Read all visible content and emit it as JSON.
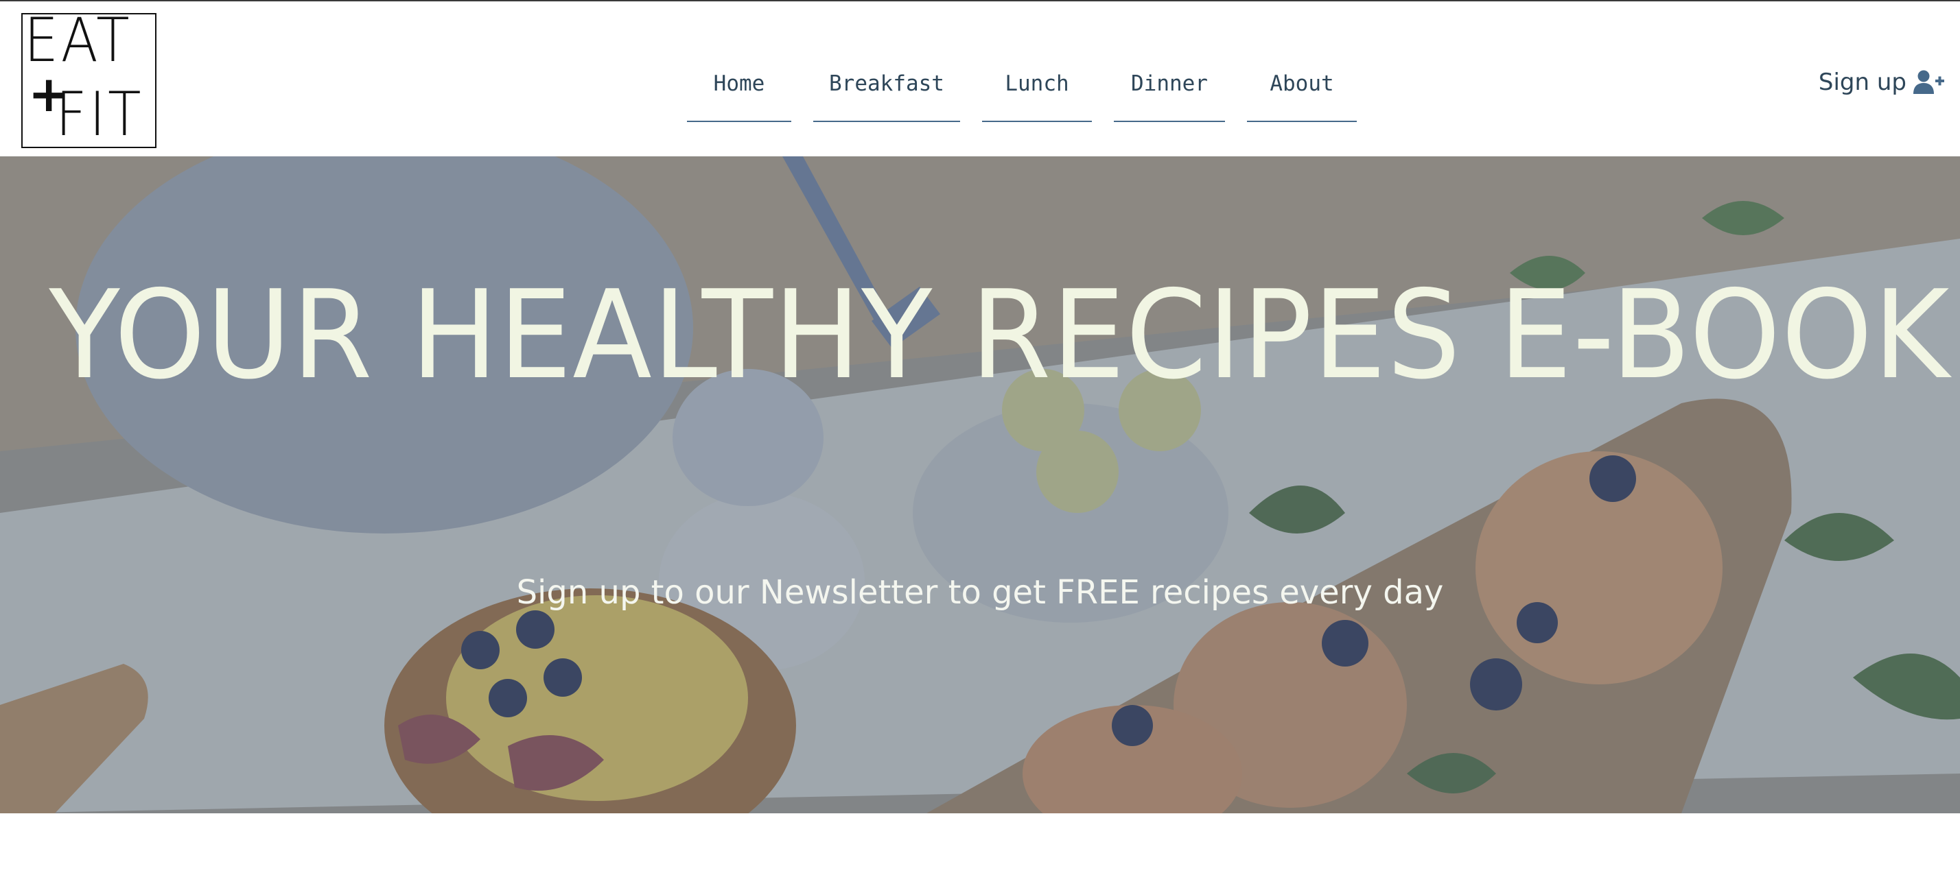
{
  "logo": {
    "line1": "EAT",
    "symbol": "+",
    "line2": "FIT"
  },
  "nav": {
    "items": [
      {
        "label": "Home"
      },
      {
        "label": "Breakfast"
      },
      {
        "label": "Lunch"
      },
      {
        "label": "Dinner"
      },
      {
        "label": "About"
      }
    ]
  },
  "header": {
    "signup_label": "Sign up",
    "signup_icon": "user-plus-icon"
  },
  "hero": {
    "title": "YOUR HEALTHY RECIPES E-BOOK!",
    "subtitle": "Sign up to our Newsletter to get FREE recipes every day",
    "background_image": "table-with-food-photo",
    "overlay_color": "#566884"
  },
  "colors": {
    "nav_text": "#2e4659",
    "nav_underline": "#46698a",
    "hero_text": "#f1f5e3"
  }
}
